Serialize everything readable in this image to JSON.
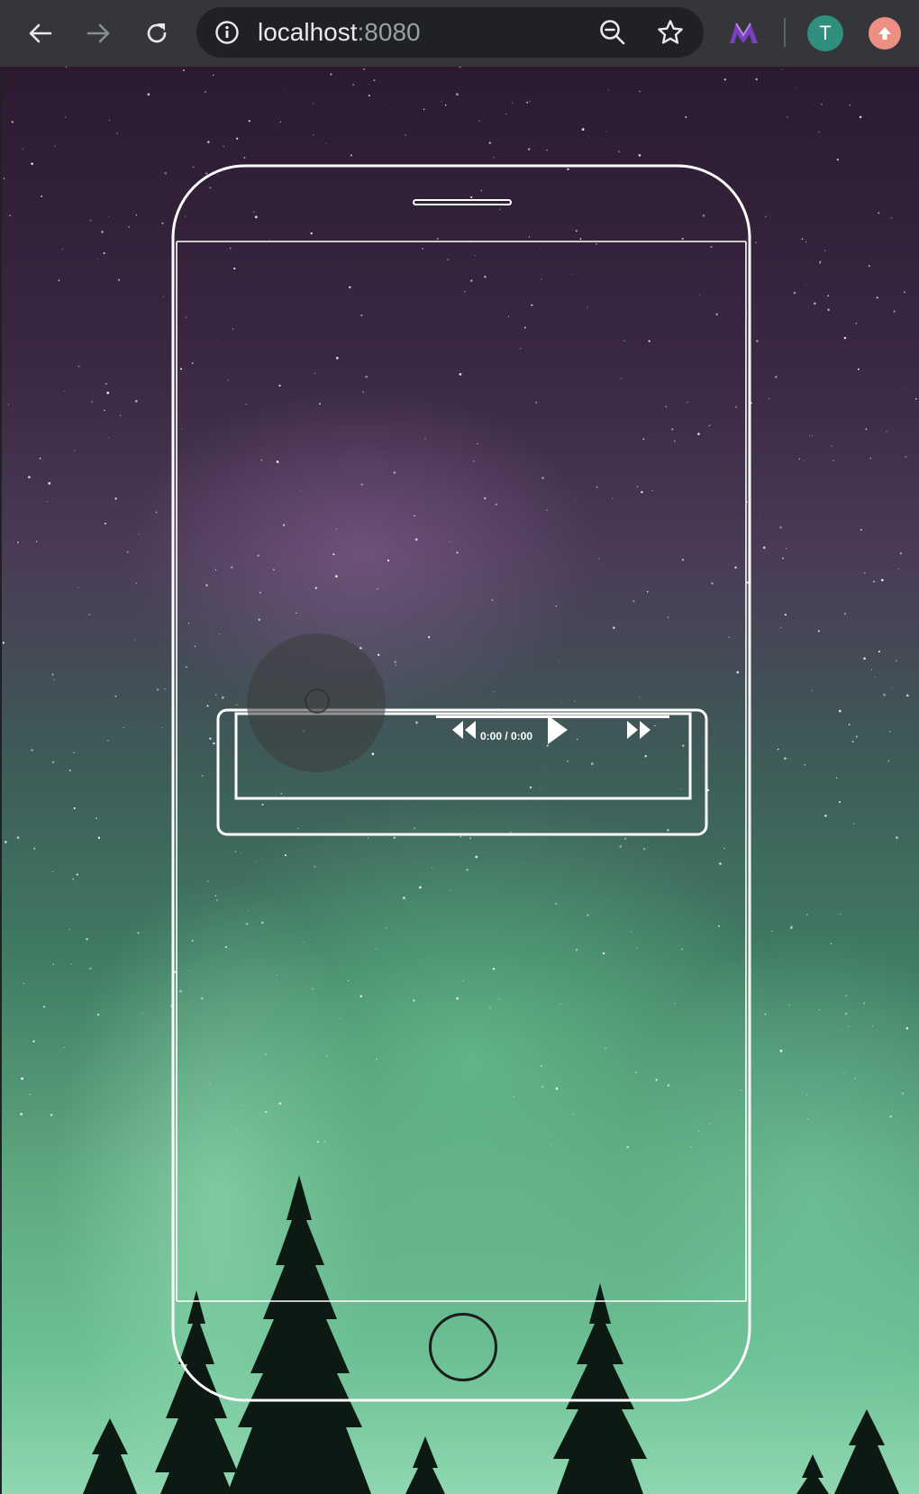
{
  "browser": {
    "url_host": "localhost",
    "url_port": ":8080",
    "profile_initial": "T",
    "icons": {
      "back": "arrow-left-icon",
      "forward": "arrow-right-icon",
      "reload": "reload-icon",
      "site_info": "info-icon",
      "zoom": "zoom-out-icon",
      "bookmark": "star-icon",
      "extension": "m-logo-icon",
      "update": "arrow-up-icon"
    },
    "colors": {
      "toolbar": "#35363a",
      "omnibox": "#202124",
      "avatar": "#2f8f7f",
      "update_badge": "#ee8f84",
      "extension": "#7b3fbf"
    }
  },
  "player": {
    "time_display": "0:00 / 0:00",
    "progress": 0,
    "icons": {
      "rewind": "rewind-icon",
      "play": "play-icon",
      "fast_forward": "fast-forward-icon"
    }
  },
  "phone": {
    "icons": {
      "speaker": "speaker-slot-icon",
      "home": "home-button-icon"
    }
  }
}
